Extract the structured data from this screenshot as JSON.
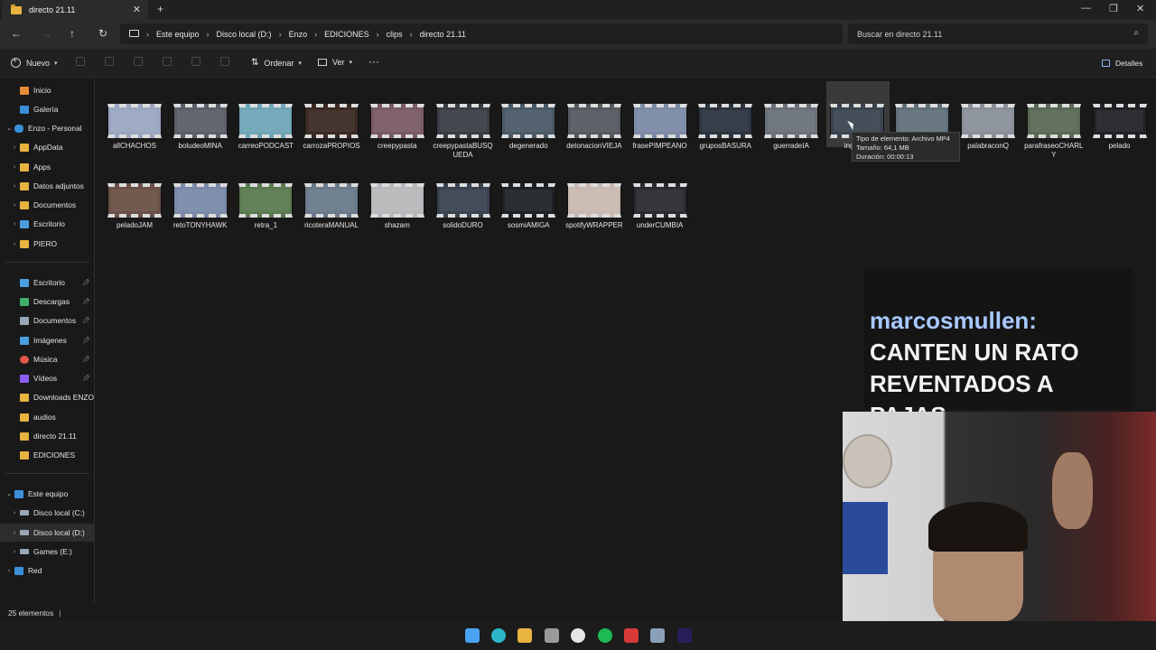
{
  "window": {
    "tab_title": "directo 21.11",
    "tab_close": "✕",
    "new_tab": "+",
    "minimize": "—",
    "maximize": "❐",
    "close": "✕"
  },
  "address": {
    "breadcrumbs": [
      "Este equipo",
      "Disco local (D:)",
      "Enzo",
      "EDICIONES",
      "clips",
      "directo 21.11"
    ],
    "search_placeholder": "Buscar en directo 21.11"
  },
  "toolbar": {
    "new_label": "Nuevo",
    "sort_label": "Ordenar",
    "view_label": "Ver",
    "more_label": "···",
    "details_label": "Detalles"
  },
  "sidebar": {
    "quick": [
      {
        "label": "Inicio",
        "icon": "home-icon",
        "color": "#e58c3a"
      },
      {
        "label": "Galería",
        "icon": "gallery-icon",
        "color": "#3a8fd9"
      },
      {
        "label": "Enzo - Personal",
        "icon": "cloud-icon",
        "color": "#3a8fd9"
      }
    ],
    "onedrive_children": [
      "AppData",
      "Apps",
      "Datos adjuntos",
      "Documentos",
      "Escritorio",
      "PIERO"
    ],
    "pinned": [
      {
        "label": "Escritorio",
        "icon": "desktop-icon",
        "color": "#4a9ee0"
      },
      {
        "label": "Descargas",
        "icon": "download-icon",
        "color": "#3fae6a"
      },
      {
        "label": "Documentos",
        "icon": "documents-icon",
        "color": "#9aa7b5"
      },
      {
        "label": "Imágenes",
        "icon": "pictures-icon",
        "color": "#4a9ee0"
      },
      {
        "label": "Música",
        "icon": "music-icon",
        "color": "#e2584a"
      },
      {
        "label": "Vídeos",
        "icon": "videos-icon",
        "color": "#8b5cf6"
      }
    ],
    "folders": [
      "Downloads ENZO",
      "audios",
      "directo 21.11",
      "EDICIONES"
    ],
    "this_pc": "Este equipo",
    "drives": [
      "Disco local (C:)",
      "Disco local (D:)",
      "Games (E:)"
    ],
    "network": "Red"
  },
  "files": [
    {
      "name": "allCHACHOS",
      "tint": "#9aa6c0"
    },
    {
      "name": "boludeoMINA",
      "tint": "#5a5f68"
    },
    {
      "name": "carreoPODCAST",
      "tint": "#6fa6b8"
    },
    {
      "name": "carrozaPROPIOS",
      "tint": "#3a2a22"
    },
    {
      "name": "creepypasta",
      "tint": "#7a5a66"
    },
    {
      "name": "creepypastaBUSQUEDA",
      "tint": "#3a3d44"
    },
    {
      "name": "degenerado",
      "tint": "#4a5a66"
    },
    {
      "name": "detonacionVIEJA",
      "tint": "#555a60"
    },
    {
      "name": "frasePIMPEANO",
      "tint": "#7b8aa6"
    },
    {
      "name": "gruposBASURA",
      "tint": "#2c3440"
    },
    {
      "name": "guerradeIA",
      "tint": "#6a7078"
    },
    {
      "name": "inglesM",
      "tint": "#3a4450"
    },
    {
      "name": "",
      "tint": "#60707a"
    },
    {
      "name": "palabraconQ",
      "tint": "#8a909a"
    },
    {
      "name": "parafraseoCHARLY",
      "tint": "#5a6a55"
    },
    {
      "name": "pelado",
      "tint": "#202226"
    },
    {
      "name": "peladoJAM",
      "tint": "#6a5046"
    },
    {
      "name": "retoTONYHAWK",
      "tint": "#7a8aa8"
    },
    {
      "name": "retra_1",
      "tint": "#5a7a50"
    },
    {
      "name": "ricoteraMANUAL",
      "tint": "#6a7a8a"
    },
    {
      "name": "shazam",
      "tint": "#b8b8bc"
    },
    {
      "name": "solidoDURO",
      "tint": "#3a4250"
    },
    {
      "name": "sosmiAMIGA",
      "tint": "#1e2228"
    },
    {
      "name": "spotifyWRAPPER",
      "tint": "#c8b8b0"
    },
    {
      "name": "underCUMBIA",
      "tint": "#2a2a30"
    }
  ],
  "tooltip": {
    "type": "Tipo de elemento: Archivo MP4",
    "size": "Tamaño: 64,1 MB",
    "duration": "Duración: 00:00:13"
  },
  "status": {
    "count": "25 elementos",
    "divider": "|"
  },
  "chat": {
    "user": "marcosmullen:",
    "message": "CANTEN UN RATO REVENTADOS A PAJAS"
  },
  "taskbar": [
    {
      "name": "start-icon",
      "color": "#4aa3f0"
    },
    {
      "name": "edge-icon",
      "color": "#2fb5c8"
    },
    {
      "name": "file-explorer-icon",
      "color": "#e8b33f"
    },
    {
      "name": "app-icon",
      "color": "#9a9a9a"
    },
    {
      "name": "obs-icon",
      "color": "#e6e6e6"
    },
    {
      "name": "spotify-icon",
      "color": "#1db954"
    },
    {
      "name": "news-app-icon",
      "color": "#d83a3a"
    },
    {
      "name": "settings-icon",
      "color": "#8aa0b8"
    },
    {
      "name": "premiere-icon",
      "color": "#2a1e5a"
    }
  ]
}
